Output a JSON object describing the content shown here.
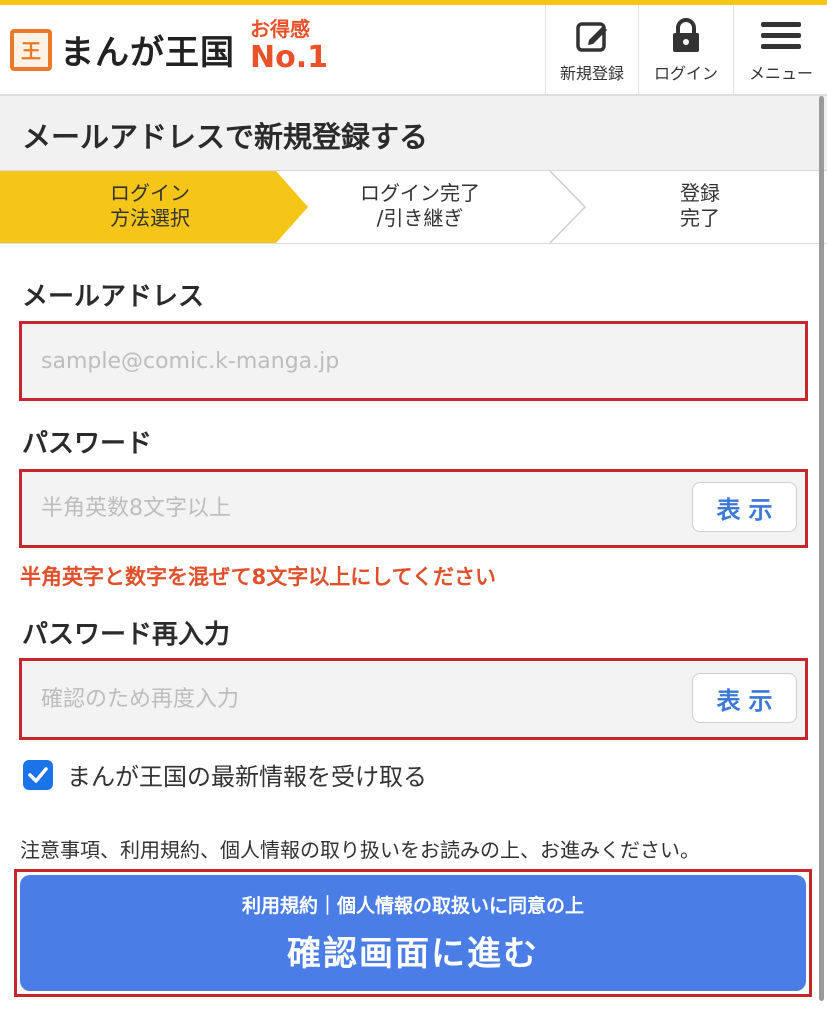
{
  "header": {
    "logo_mark": "王",
    "logo_text": "まんが王国",
    "badge_line1": "お得感",
    "badge_line2": "No.1",
    "nav": [
      {
        "label": "新規登録",
        "icon": "edit-icon"
      },
      {
        "label": "ログイン",
        "icon": "lock-icon"
      },
      {
        "label": "メニュー",
        "icon": "hamburger-menu-icon"
      }
    ]
  },
  "page_title": "メールアドレスで新規登録する",
  "steps": [
    {
      "line1": "ログイン",
      "line2": "方法選択",
      "active": true
    },
    {
      "line1": "ログイン完了",
      "line2": "/引き継ぎ",
      "active": false
    },
    {
      "line1": "登録",
      "line2": "完了",
      "active": false
    }
  ],
  "form": {
    "email": {
      "label": "メールアドレス",
      "placeholder": "sample@comic.k-manga.jp",
      "value": ""
    },
    "password": {
      "label": "パスワード",
      "placeholder": "半角英数8文字以上",
      "value": "",
      "show_label": "表示"
    },
    "password_error": "半角英字と数字を混ぜて8文字以上にしてください",
    "password_confirm": {
      "label": "パスワード再入力",
      "placeholder": "確認のため再度入力",
      "value": "",
      "show_label": "表示"
    },
    "newsletter": {
      "label": "まんが王国の最新情報を受け取る",
      "checked": true
    }
  },
  "notice": "注意事項、利用規約、個人情報の取り扱いをお読みの上、お進みください。",
  "submit": {
    "subtext": "利用規約｜個人情報の取扱いに同意の上",
    "label": "確認画面に進む"
  },
  "colors": {
    "accent_yellow": "#f5c518",
    "error_red": "#c8262e",
    "error_text": "#e0502a",
    "button_blue": "#4a7ee6",
    "link_blue": "#3b78d8"
  }
}
